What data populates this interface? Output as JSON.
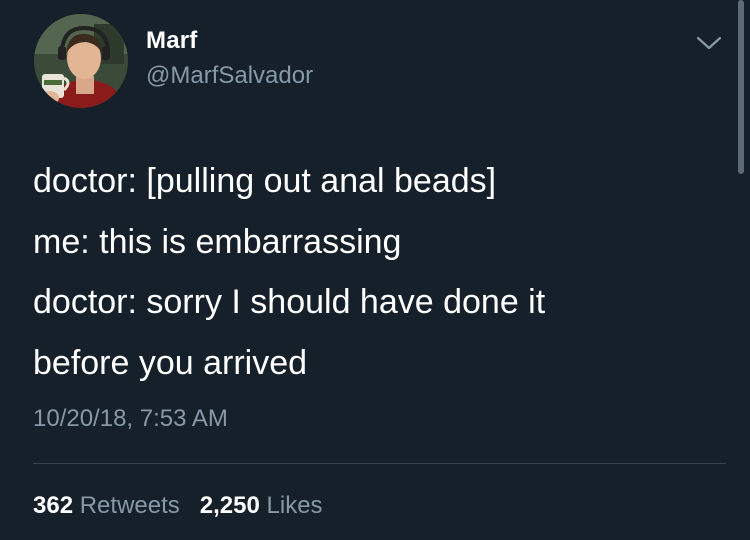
{
  "author": {
    "display_name": "Marf",
    "handle": "@MarfSalvador",
    "avatar_icon": "profile-photo"
  },
  "tweet": {
    "lines": [
      "doctor: [pulling out anal beads]",
      "me: this is embarrassing",
      "doctor: sorry I should have done it",
      "before you arrived"
    ],
    "timestamp": "10/20/18, 7:53 AM"
  },
  "stats": {
    "retweets_count": "362",
    "retweets_label": "Retweets",
    "likes_count": "2,250",
    "likes_label": "Likes"
  },
  "colors": {
    "background": "#15202b",
    "text": "#ffffff",
    "secondary_text": "#8899a6",
    "divider": "#38444d"
  },
  "icons": {
    "menu": "chevron-down-icon"
  }
}
